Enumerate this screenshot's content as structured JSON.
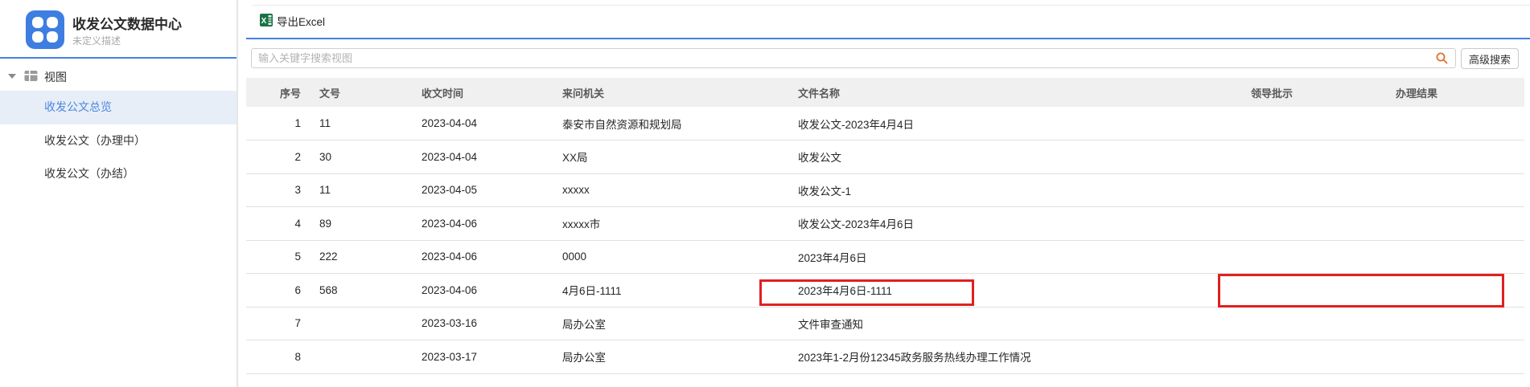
{
  "sidebar": {
    "title": "收发公文数据中心",
    "subtitle": "未定义描述",
    "tree_label": "视图",
    "items": [
      {
        "label": "收发公文总览"
      },
      {
        "label": "收发公文（办理中）"
      },
      {
        "label": "收发公文（办结）"
      }
    ]
  },
  "toolbar": {
    "export_label": "导出Excel"
  },
  "search": {
    "placeholder": "输入关键字搜索视图",
    "advanced_label": "高级搜索"
  },
  "table": {
    "columns": [
      "序号",
      "文号",
      "收文时间",
      "来问机关",
      "文件名称",
      "领导批示",
      "办理结果"
    ],
    "rows": [
      [
        "1",
        "11",
        "2023-04-04",
        "泰安市自然资源和规划局",
        "收发公文-2023年4月4日",
        "",
        ""
      ],
      [
        "2",
        "30",
        "2023-04-04",
        "XX局",
        "收发公文",
        "",
        ""
      ],
      [
        "3",
        "11",
        "2023-04-05",
        "xxxxx",
        "收发公文-1",
        "",
        ""
      ],
      [
        "4",
        "89",
        "2023-04-06",
        "xxxxx市",
        "收发公文-2023年4月6日",
        "",
        ""
      ],
      [
        "5",
        "222",
        "2023-04-06",
        "0000",
        "2023年4月6日",
        "",
        ""
      ],
      [
        "6",
        "568",
        "2023-04-06",
        "4月6日-1111",
        "2023年4月6日-1111",
        "",
        ""
      ],
      [
        "7",
        "",
        "2023-03-16",
        "局办公室",
        "文件审查通知",
        "",
        ""
      ],
      [
        "8",
        "",
        "2023-03-17",
        "局办公室",
        "2023年1-2月份12345政务服务热线办理工作情况",
        "",
        ""
      ]
    ]
  },
  "colors": {
    "accent_blue": "#4580e4",
    "selected_item_bg": "#e8eef8",
    "selected_item_text": "#4a86e0",
    "excel_green": "#1a7343",
    "search_icon_orange": "#e2702a",
    "table_header_bg": "#f0f0f0",
    "annotation_red": "#e02020"
  }
}
